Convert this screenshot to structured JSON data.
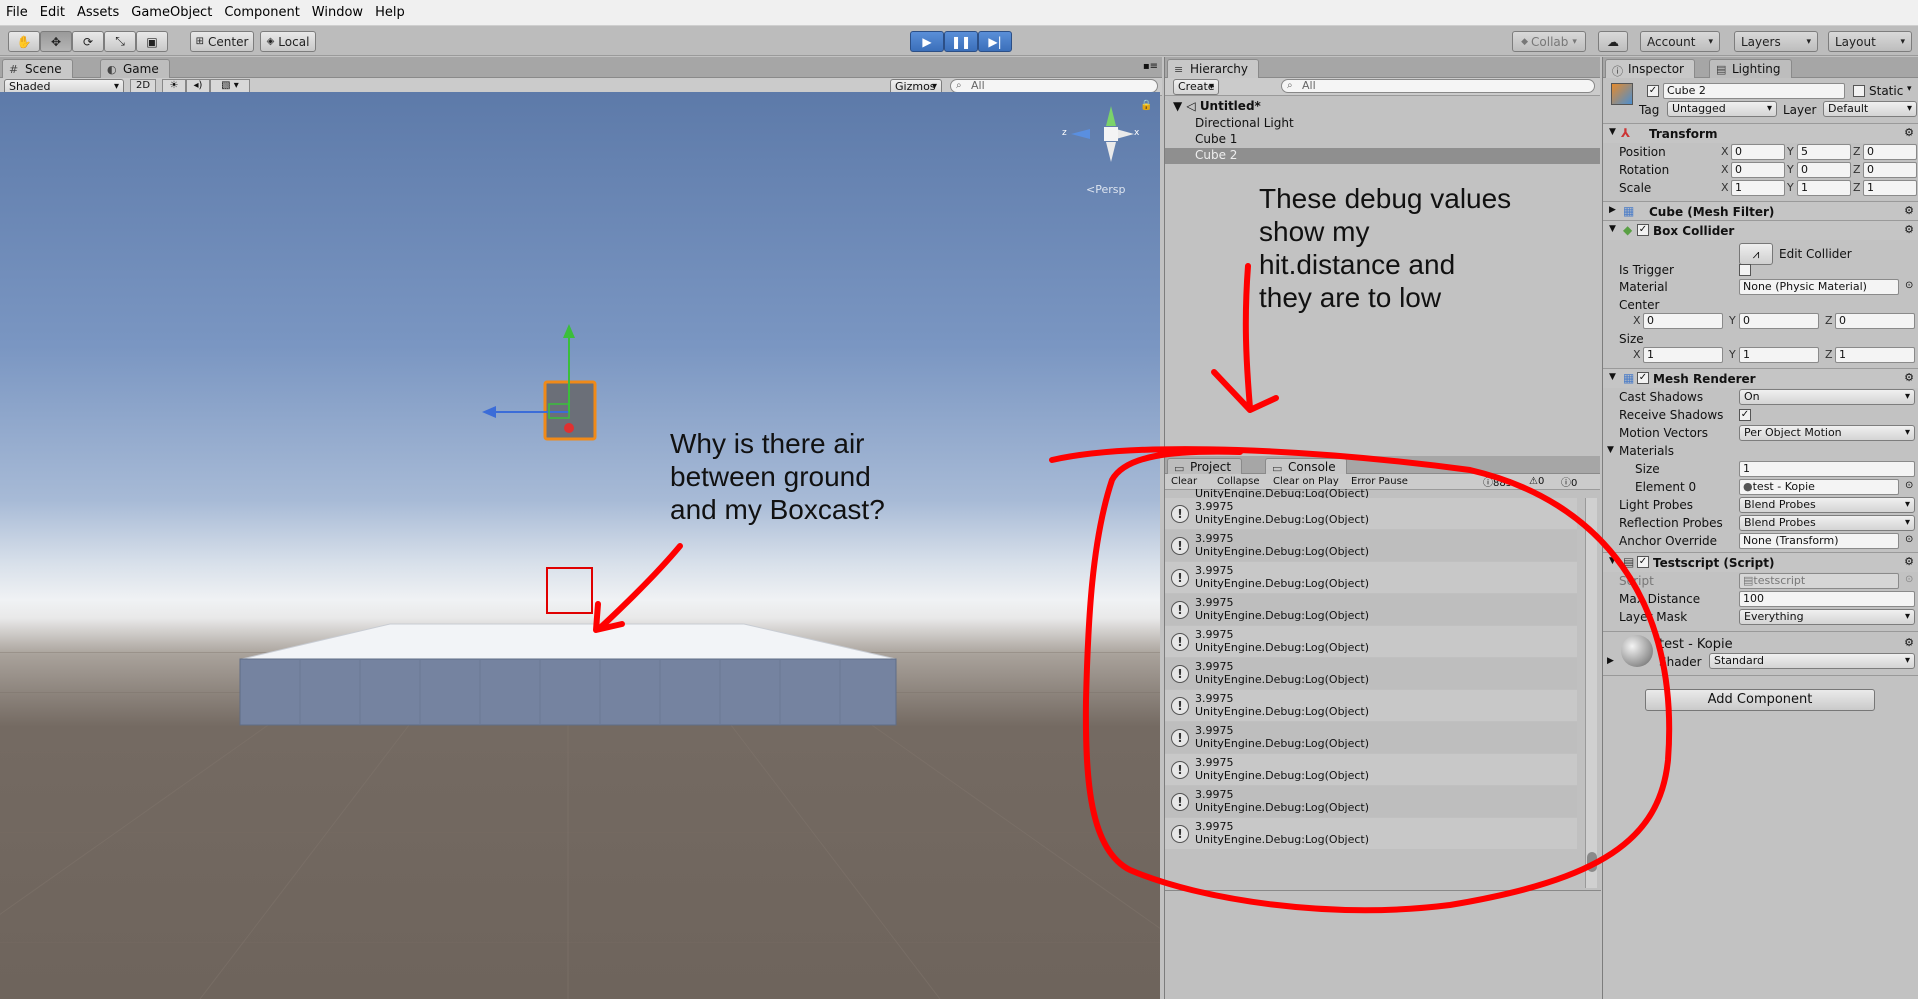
{
  "menu": [
    "File",
    "Edit",
    "Assets",
    "GameObject",
    "Component",
    "Window",
    "Help"
  ],
  "toolbar": {
    "pivot_label": "Center",
    "space_label": "Local",
    "collab_label": "Collab",
    "account_label": "Account",
    "layers_label": "Layers",
    "layout_label": "Layout"
  },
  "scene": {
    "tab_scene": "Scene",
    "tab_game": "Game",
    "shading": "Shaded",
    "mode_2d": "2D",
    "gizmos": "Gizmos",
    "search_placeholder": "All",
    "persp_label": "Persp",
    "axis_x": "x",
    "axis_z": "z"
  },
  "hierarchy": {
    "tab": "Hierarchy",
    "create_label": "Create",
    "search_placeholder": "All",
    "scene_name": "Untitled*",
    "items": [
      "Directional Light",
      "Cube 1",
      "Cube 2"
    ]
  },
  "console": {
    "tab_project": "Project",
    "tab_console": "Console",
    "buttons": [
      "Clear",
      "Collapse",
      "Clear on Play",
      "Error Pause"
    ],
    "counts": {
      "log": "885",
      "warn": "0",
      "error": "0"
    },
    "partial_line": "UnityEngine.Debug:Log(Object)",
    "entries": [
      {
        "value": "3.9975",
        "source": "UnityEngine.Debug:Log(Object)"
      },
      {
        "value": "3.9975",
        "source": "UnityEngine.Debug:Log(Object)"
      },
      {
        "value": "3.9975",
        "source": "UnityEngine.Debug:Log(Object)"
      },
      {
        "value": "3.9975",
        "source": "UnityEngine.Debug:Log(Object)"
      },
      {
        "value": "3.9975",
        "source": "UnityEngine.Debug:Log(Object)"
      },
      {
        "value": "3.9975",
        "source": "UnityEngine.Debug:Log(Object)"
      },
      {
        "value": "3.9975",
        "source": "UnityEngine.Debug:Log(Object)"
      },
      {
        "value": "3.9975",
        "source": "UnityEngine.Debug:Log(Object)"
      },
      {
        "value": "3.9975",
        "source": "UnityEngine.Debug:Log(Object)"
      },
      {
        "value": "3.9975",
        "source": "UnityEngine.Debug:Log(Object)"
      },
      {
        "value": "3.9975",
        "source": "UnityEngine.Debug:Log(Object)"
      }
    ]
  },
  "inspector": {
    "tab_inspector": "Inspector",
    "tab_lighting": "Lighting",
    "object_name": "Cube 2",
    "static_label": "Static",
    "tag_label": "Tag",
    "tag_value": "Untagged",
    "layer_label": "Layer",
    "layer_value": "Default",
    "transform": {
      "title": "Transform",
      "position_label": "Position",
      "rotation_label": "Rotation",
      "scale_label": "Scale",
      "position": [
        "0",
        "5",
        "0"
      ],
      "rotation": [
        "0",
        "0",
        "0"
      ],
      "scale": [
        "1",
        "1",
        "1"
      ]
    },
    "mesh_filter_title": "Cube (Mesh Filter)",
    "box_collider": {
      "title": "Box Collider",
      "edit_collider": "Edit Collider",
      "is_trigger_label": "Is Trigger",
      "material_label": "Material",
      "material_value": "None (Physic Material)",
      "center_label": "Center",
      "center": [
        "0",
        "0",
        "0"
      ],
      "size_label": "Size",
      "size": [
        "1",
        "1",
        "1"
      ]
    },
    "mesh_renderer": {
      "title": "Mesh Renderer",
      "cast_shadows_label": "Cast Shadows",
      "cast_shadows_value": "On",
      "receive_shadows_label": "Receive Shadows",
      "motion_vectors_label": "Motion Vectors",
      "motion_vectors_value": "Per Object Motion",
      "materials_label": "Materials",
      "size_label": "Size",
      "size_value": "1",
      "element0_label": "Element 0",
      "element0_value": "test - Kopie",
      "light_probes_label": "Light Probes",
      "light_probes_value": "Blend Probes",
      "reflection_probes_label": "Reflection Probes",
      "reflection_probes_value": "Blend Probes",
      "anchor_override_label": "Anchor Override",
      "anchor_override_value": "None (Transform)"
    },
    "testscript": {
      "title": "Testscript (Script)",
      "script_label": "Script",
      "script_value": "testscript",
      "max_distance_label": "Max Distance",
      "max_distance_value": "100",
      "layer_mask_label": "Layer Mask",
      "layer_mask_value": "Everything"
    },
    "material": {
      "name": "test - Kopie",
      "shader_label": "Shader",
      "shader_value": "Standard"
    },
    "add_component": "Add Component"
  },
  "annotations": {
    "question": [
      "Why is there air",
      "between ground",
      "and my Boxcast?"
    ],
    "debug_note": [
      "These debug values",
      "show my",
      "hit.distance and",
      "they are to low"
    ]
  },
  "colors": {
    "annotation_red": "#ff0000",
    "play_blue": "#3b6fba",
    "selection_orange": "#f08a18"
  }
}
